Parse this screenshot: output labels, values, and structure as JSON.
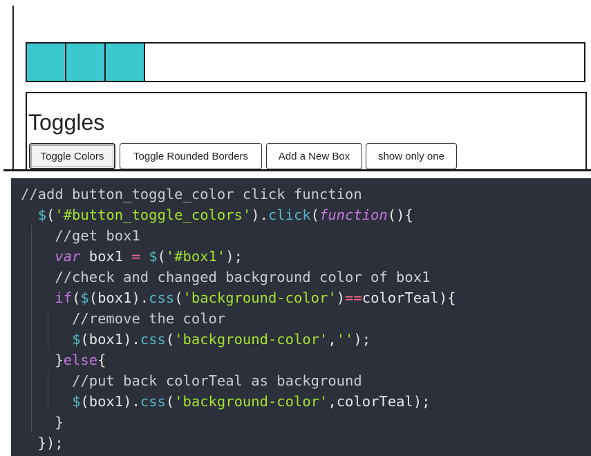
{
  "boxes": {
    "count_filled": 3,
    "fill_color": "#3cc8cf"
  },
  "toggles": {
    "title": "Toggles",
    "buttons": [
      {
        "label": "Toggle Colors",
        "active": true
      },
      {
        "label": "Toggle Rounded Borders",
        "active": false
      },
      {
        "label": "Add a New Box",
        "active": false
      },
      {
        "label": "show only one",
        "active": false
      }
    ]
  },
  "code": {
    "lines": [
      [
        [
          "comment",
          "//add button_toggle_color click function"
        ]
      ],
      [
        [
          "plain",
          "  "
        ],
        [
          "fn",
          "$"
        ],
        [
          "punc",
          "("
        ],
        [
          "str",
          "'#button_toggle_colors'"
        ],
        [
          "punc",
          ")."
        ],
        [
          "fn",
          "click"
        ],
        [
          "punc",
          "("
        ],
        [
          "kwi",
          "function"
        ],
        [
          "punc",
          "(){"
        ]
      ],
      [
        [
          "plain",
          "    "
        ],
        [
          "comment",
          "//get box1"
        ]
      ],
      [
        [
          "plain",
          "    "
        ],
        [
          "kwi",
          "var"
        ],
        [
          "plain",
          " box1 "
        ],
        [
          "op",
          "="
        ],
        [
          "plain",
          " "
        ],
        [
          "fn",
          "$"
        ],
        [
          "punc",
          "("
        ],
        [
          "str",
          "'#box1'"
        ],
        [
          "punc",
          ");"
        ]
      ],
      [
        [
          "plain",
          "    "
        ],
        [
          "comment",
          "//check and changed background color of box1"
        ]
      ],
      [
        [
          "plain",
          "    "
        ],
        [
          "kw",
          "if"
        ],
        [
          "punc",
          "("
        ],
        [
          "fn",
          "$"
        ],
        [
          "punc",
          "(box1)."
        ],
        [
          "fn",
          "css"
        ],
        [
          "punc",
          "("
        ],
        [
          "str",
          "'background-color'"
        ],
        [
          "punc",
          ")"
        ],
        [
          "op",
          "=="
        ],
        [
          "plain",
          "colorTeal){"
        ]
      ],
      [
        [
          "plain",
          "      "
        ],
        [
          "comment",
          "//remove the color"
        ]
      ],
      [
        [
          "plain",
          "      "
        ],
        [
          "fn",
          "$"
        ],
        [
          "punc",
          "(box1)."
        ],
        [
          "fn",
          "css"
        ],
        [
          "punc",
          "("
        ],
        [
          "str",
          "'background-color'"
        ],
        [
          "punc",
          ","
        ],
        [
          "str",
          "''"
        ],
        [
          "punc",
          ");"
        ]
      ],
      [
        [
          "plain",
          "    "
        ],
        [
          "punc",
          "}"
        ],
        [
          "kw",
          "else"
        ],
        [
          "punc",
          "{"
        ]
      ],
      [
        [
          "plain",
          "      "
        ],
        [
          "comment",
          "//put back colorTeal as background"
        ]
      ],
      [
        [
          "plain",
          "      "
        ],
        [
          "fn",
          "$"
        ],
        [
          "punc",
          "(box1)."
        ],
        [
          "fn",
          "css"
        ],
        [
          "punc",
          "("
        ],
        [
          "str",
          "'background-color'"
        ],
        [
          "punc",
          ",colorTeal);"
        ]
      ],
      [
        [
          "plain",
          "    "
        ],
        [
          "punc",
          "}"
        ]
      ],
      [
        [
          "plain",
          "  "
        ],
        [
          "punc",
          "});"
        ]
      ]
    ]
  }
}
